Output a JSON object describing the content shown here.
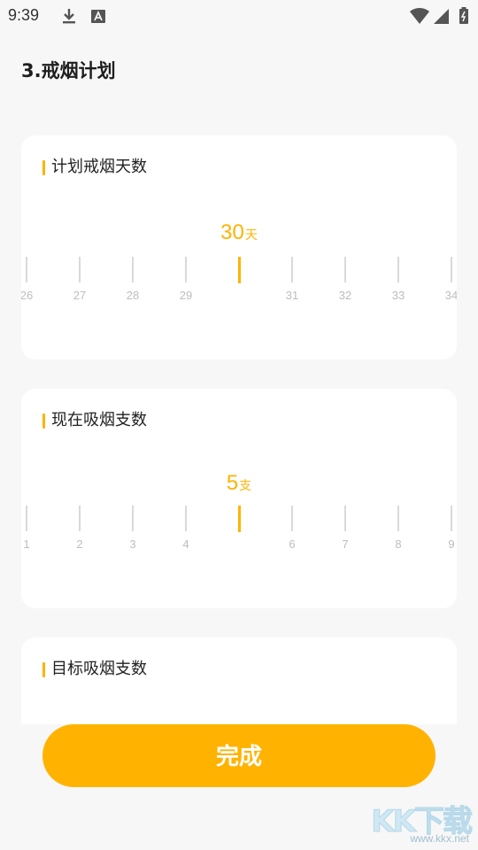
{
  "status_bar": {
    "time": "9:39",
    "icons": [
      "download-icon",
      "a-notification-icon",
      "wifi-icon",
      "signal-icon",
      "battery-icon"
    ]
  },
  "page": {
    "title": "3.戒烟计划"
  },
  "cards": [
    {
      "title": "计划戒烟天数",
      "value": "30",
      "unit": "天",
      "ticks": [
        "26",
        "27",
        "28",
        "29",
        "",
        "31",
        "32",
        "33",
        "34"
      ]
    },
    {
      "title": "现在吸烟支数",
      "value": "5",
      "unit": "支",
      "ticks": [
        "1",
        "2",
        "3",
        "4",
        "",
        "6",
        "7",
        "8",
        "9"
      ]
    },
    {
      "title": "目标吸烟支数"
    }
  ],
  "footer": {
    "done_label": "完成"
  },
  "watermark": {
    "main": "KK下载",
    "sub": "www.kkx.net"
  },
  "colors": {
    "accent": "#ffb300",
    "background": "#f7f7f7",
    "card": "#ffffff",
    "tick": "#d9d9d9",
    "tick_label": "#bdbdbd"
  }
}
